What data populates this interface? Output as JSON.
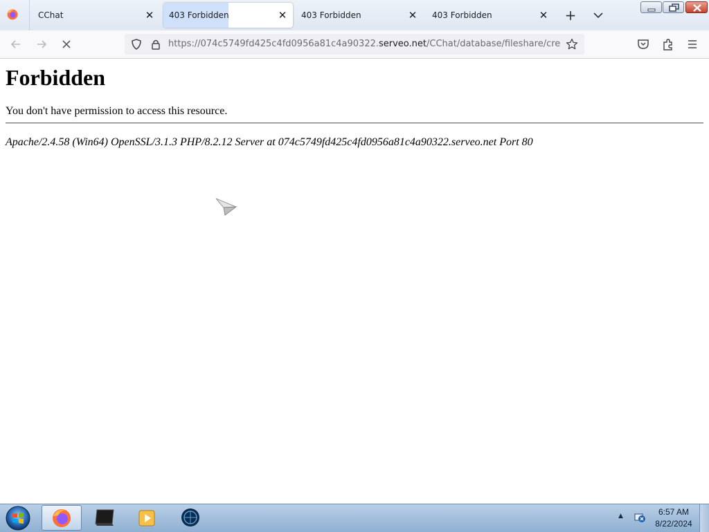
{
  "browser": {
    "tabs": [
      {
        "title": "CChat",
        "active": false
      },
      {
        "title": "403 Forbidden",
        "active": true
      },
      {
        "title": "403 Forbidden",
        "active": false
      },
      {
        "title": "403 Forbidden",
        "active": false
      }
    ],
    "tab_close_glyph": "✕",
    "new_tab_glyph": "+",
    "url": {
      "prefix": "https://074c5749fd425c4fd0956a81c4a90322.",
      "domain": "serveo.net",
      "path": "/CChat/database/fileshare/creeper/"
    },
    "accent_color": "#cfe1fa"
  },
  "page": {
    "heading": "Forbidden",
    "message": "You don't have permission to access this resource.",
    "server_signature": "Apache/2.4.58 (Win64) OpenSSL/3.1.3 PHP/8.2.12 Server at 074c5749fd425c4fd0956a81c4a90322.serveo.net Port 80"
  },
  "taskbar": {
    "clock_time": "6:57 AM",
    "clock_date": "8/22/2024",
    "tray_arrow": "▲",
    "items": [
      "firefox-icon",
      "terminal-icon",
      "media-player-icon",
      "globe-app-icon"
    ]
  }
}
